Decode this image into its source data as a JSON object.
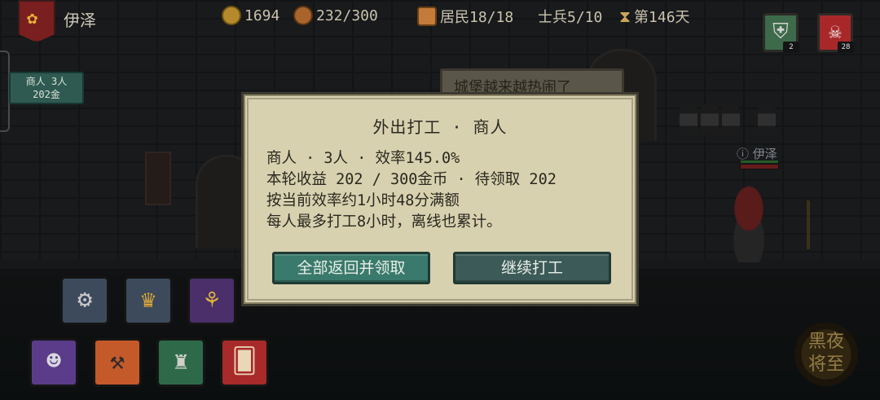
{
  "player": {
    "name": "伊泽"
  },
  "resources": {
    "gold": "1694",
    "food": "232/300",
    "residents": "居民18/18",
    "soldiers": "士兵5/10",
    "day": "第146天"
  },
  "top_cards": {
    "knight_count": "2",
    "skull_count": "28"
  },
  "worker_badge": {
    "line1": "商人 3人",
    "line2": "202金"
  },
  "background": {
    "sign_text": "城堡越来越热闹了"
  },
  "hero": {
    "name": "伊泽"
  },
  "night_badge": {
    "line1": "黑夜",
    "line2": "将至"
  },
  "dialog": {
    "title": "外出打工 · 商人",
    "line1": "商人 · 3人 · 效率145.0%",
    "line2": "本轮收益 202 / 300金币 · 待领取 202",
    "line3": "按当前效率约1小时48分满额",
    "line4": "每人最多打工8小时，离线也累计。",
    "return_button": "全部返回并领取",
    "continue_button": "继续打工"
  }
}
